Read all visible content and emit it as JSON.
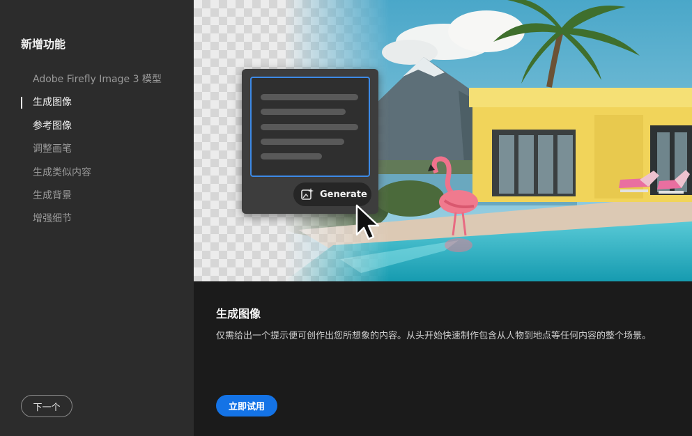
{
  "sidebar": {
    "title": "新增功能",
    "items": [
      {
        "label": "Adobe Firefly Image 3 模型"
      },
      {
        "label": "生成图像"
      },
      {
        "label": "参考图像"
      },
      {
        "label": "调整画笔"
      },
      {
        "label": "生成类似内容"
      },
      {
        "label": "生成背景"
      },
      {
        "label": "增强细节"
      }
    ],
    "active_index": 1,
    "next_label": "下一个"
  },
  "hero": {
    "generate_label": "Generate",
    "icons": [
      "generate-sparkle-icon",
      "mouse-pointer-icon"
    ]
  },
  "content": {
    "title": "生成图像",
    "description": "仅需给出一个提示便可创作出您所想象的内容。从头开始快速制作包含从人物到地点等任何内容的整个场景。",
    "try_label": "立即试用"
  },
  "colors": {
    "accent": "#1473e6",
    "sidebar_bg": "#2c2c2c",
    "content_bg": "#1b1b1b",
    "prompt_border": "#3d8ae6"
  }
}
